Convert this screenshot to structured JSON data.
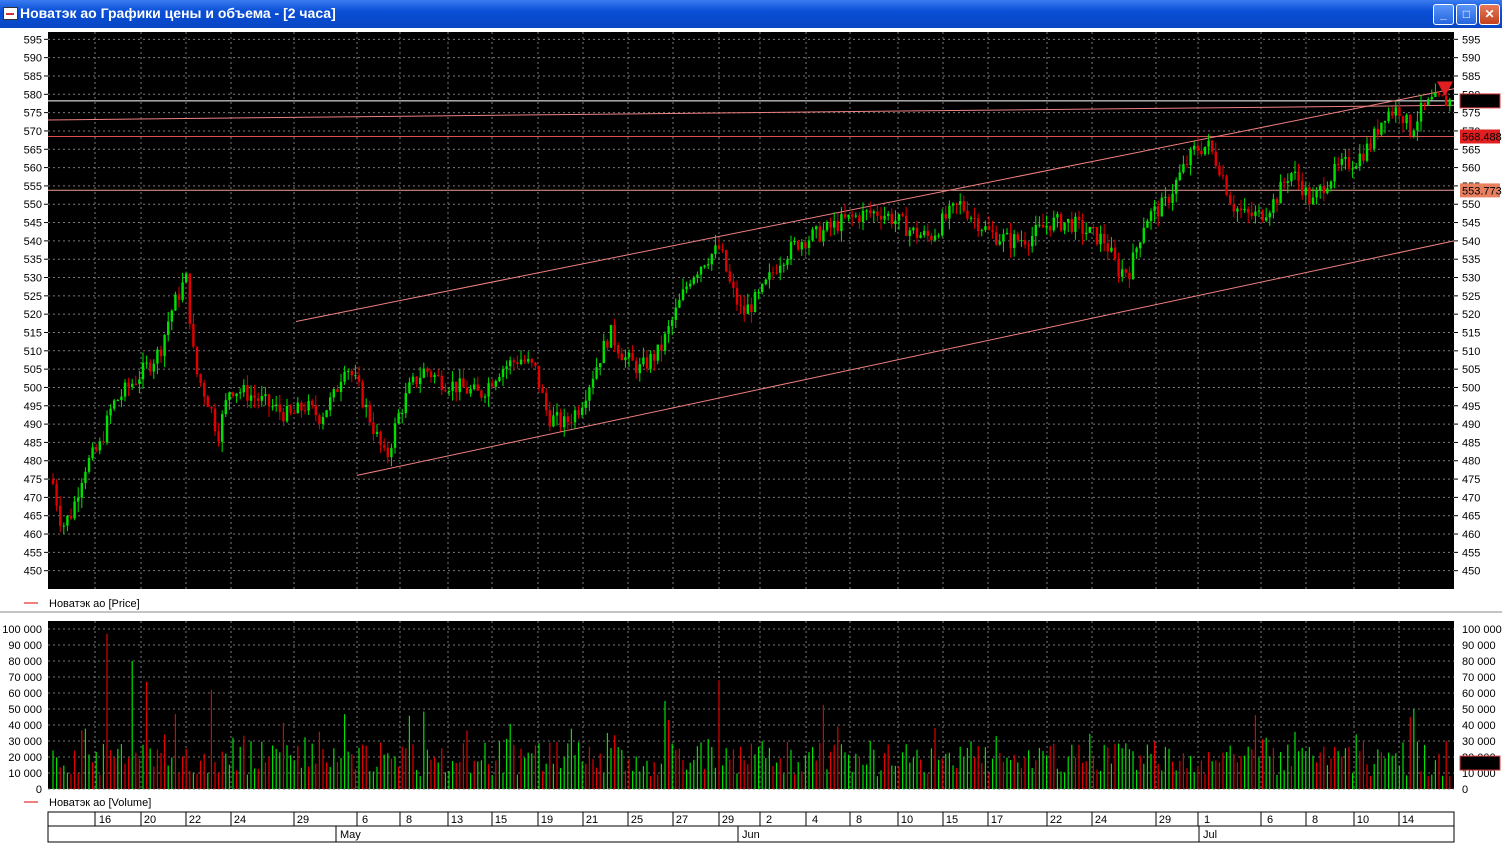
{
  "window": {
    "title": "Новатэк ао Графики цены и объема - [2 часа]",
    "buttons": [
      "minimize",
      "maximize",
      "close"
    ]
  },
  "colors": {
    "background": "#000000",
    "grid": "#7a7a7a",
    "up": "#00e000",
    "down": "#e00000",
    "trendline": "#f08080",
    "level": "#e8a090",
    "current": "#ffffff"
  },
  "chart_data": [
    {
      "type": "candlestick",
      "legend": "Новатэк ао [Price]",
      "ylim": [
        445,
        597
      ],
      "y_ticks": [
        450,
        455,
        460,
        465,
        470,
        475,
        480,
        485,
        490,
        495,
        500,
        505,
        510,
        515,
        520,
        525,
        530,
        535,
        540,
        545,
        550,
        555,
        560,
        565,
        570,
        575,
        580,
        585,
        590,
        595
      ],
      "price_markers": [
        {
          "label": "578.2",
          "value": 578.2
        },
        {
          "label": "568.488",
          "value": 568.488
        },
        {
          "label": "553.773",
          "value": 553.773
        }
      ],
      "horizontal_levels": [
        578.2,
        568.5,
        553.8
      ],
      "trendlines": [
        {
          "from": [
            "29",
            518
          ],
          "to": [
            "14",
            581.5
          ]
        },
        {
          "from": [
            "6",
            476
          ],
          "to": [
            "end",
            540
          ]
        },
        {
          "from": [
            "start",
            573
          ],
          "to": [
            "end",
            577
          ]
        }
      ],
      "close_path": [
        [
          "start",
          476
        ],
        [
          "16",
          484
        ],
        [
          "20",
          500
        ],
        [
          "22",
          530
        ],
        [
          "22b",
          505
        ],
        [
          "24",
          490
        ],
        [
          "29",
          495
        ],
        [
          "6",
          505
        ],
        [
          "7",
          480
        ],
        [
          "8",
          495
        ],
        [
          "13",
          505
        ],
        [
          "15",
          500
        ],
        [
          "19",
          508
        ],
        [
          "21",
          490
        ],
        [
          "25",
          515
        ],
        [
          "27",
          510
        ],
        [
          "29b",
          538
        ],
        [
          "29",
          522
        ],
        [
          "2",
          535
        ],
        [
          "4",
          545
        ],
        [
          "8",
          548
        ],
        [
          "10",
          544
        ],
        [
          "15",
          550
        ],
        [
          "17",
          543
        ],
        [
          "22",
          546
        ],
        [
          "24",
          540
        ],
        [
          "26",
          530
        ],
        [
          "29",
          555
        ],
        [
          "1",
          568
        ],
        [
          "3",
          548
        ],
        [
          "6",
          548
        ],
        [
          "8",
          560
        ],
        [
          "9",
          548
        ],
        [
          "10",
          558
        ],
        [
          "12",
          565
        ],
        [
          "14",
          575
        ],
        [
          "end",
          578.2
        ]
      ]
    },
    {
      "type": "bar",
      "legend": "Новатэк ао [Volume]",
      "ylim": [
        0,
        105000
      ],
      "y_ticks": [
        "0",
        "10 000",
        "20 000",
        "30 000",
        "40 000",
        "50 000",
        "60 000",
        "70 000",
        "80 000",
        "90 000",
        "100 000"
      ],
      "current_label": "16 200",
      "current_value": 16200,
      "peaks": [
        [
          "16",
          97000
        ],
        [
          "17",
          80000
        ],
        [
          "20",
          67000
        ],
        [
          "22",
          62000
        ],
        [
          "27",
          55000
        ],
        [
          "29",
          68000
        ],
        [
          "4",
          50000
        ],
        [
          "1",
          50000
        ],
        [
          "12",
          50000
        ]
      ]
    }
  ],
  "x_axis": {
    "day_labels": [
      "16",
      "20",
      "22",
      "24",
      "29",
      "6",
      "8",
      "13",
      "15",
      "19",
      "21",
      "25",
      "27",
      "29",
      "2",
      "4",
      "8",
      "10",
      "15",
      "17",
      "22",
      "24",
      "29",
      "1",
      "6",
      "8",
      "10",
      "14"
    ],
    "month_labels": [
      "May",
      "Jun",
      "Jul"
    ]
  }
}
